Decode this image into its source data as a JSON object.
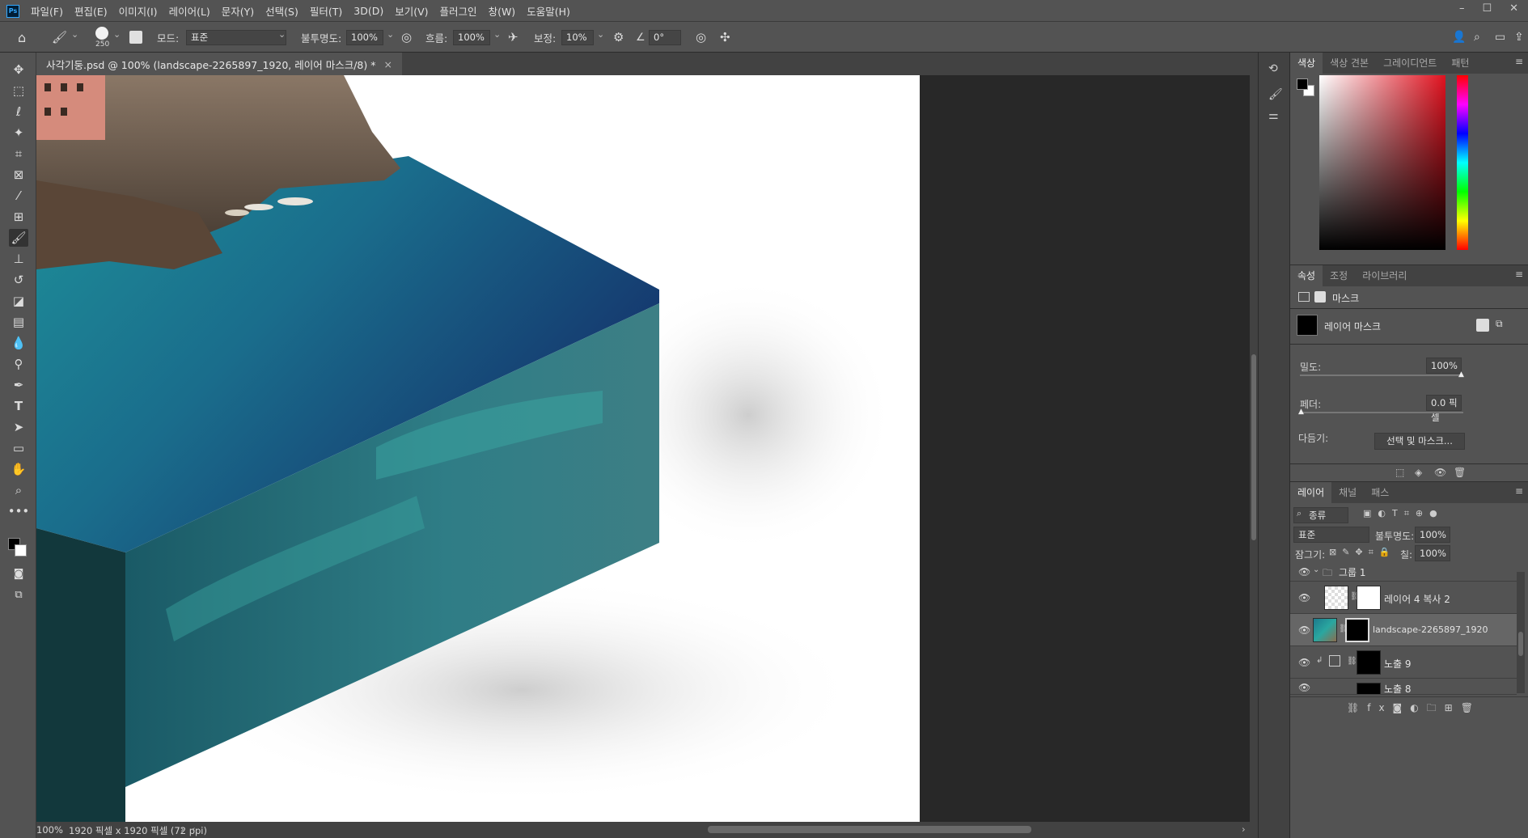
{
  "app": {
    "logo": "Ps"
  },
  "menu": [
    "파일(F)",
    "편집(E)",
    "이미지(I)",
    "레이어(L)",
    "문자(Y)",
    "선택(S)",
    "필터(T)",
    "3D(D)",
    "보기(V)",
    "플러그인",
    "창(W)",
    "도움말(H)"
  ],
  "options": {
    "brush_size": "250",
    "mode_label": "모드:",
    "mode_value": "표준",
    "opacity_label": "불투명도:",
    "opacity_value": "100%",
    "flow_label": "흐름:",
    "flow_value": "100%",
    "smoothing_label": "보정:",
    "smoothing_value": "10%",
    "angle_value": "0°"
  },
  "document": {
    "tab_title": "사각기둥.psd @ 100% (landscape-2265897_1920, 레이어 마스크/8) *",
    "zoom": "100%",
    "doc_info": "1920 픽셀 x 1920 픽셀 (72 ppi)"
  },
  "color_panel": {
    "tabs": [
      "색상",
      "색상 견본",
      "그레이디언트",
      "패턴"
    ],
    "foreground": "#000000",
    "background": "#ffffff"
  },
  "properties_panel": {
    "tabs": [
      "속성",
      "조정",
      "라이브러리"
    ],
    "mask_header": "마스크",
    "mask_type": "레이어 마스크",
    "density_label": "밀도:",
    "density_value": "100%",
    "feather_label": "페더:",
    "feather_value": "0.0 픽셀",
    "refine_label": "다듬기:",
    "select_mask_button": "선택 및 마스크..."
  },
  "layers_panel": {
    "tabs": [
      "레이어",
      "채널",
      "패스"
    ],
    "filter_label": "종류",
    "blend_mode": "표준",
    "opacity_label": "불투명도:",
    "opacity_value": "100%",
    "lock_label": "잠그기:",
    "fill_label": "칠:",
    "fill_value": "100%",
    "layers": [
      {
        "name": "그룹 1"
      },
      {
        "name": "레이어 4 복사 2"
      },
      {
        "name": "landscape-2265897_1920"
      },
      {
        "name": "노출 9"
      },
      {
        "name": "노출 8"
      }
    ]
  }
}
